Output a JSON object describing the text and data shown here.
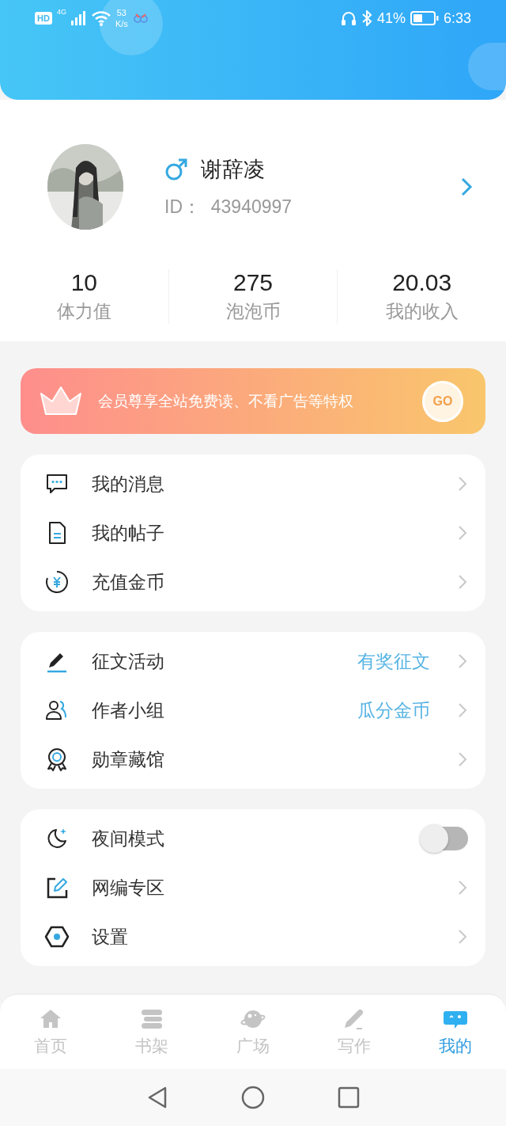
{
  "status_bar": {
    "hd": "HD",
    "network": "4G",
    "speed_value": "53",
    "speed_unit": "K/s",
    "battery": "41%",
    "time": "6:33"
  },
  "profile": {
    "name": "谢辞凌",
    "id": "ID：  43940997"
  },
  "stats": [
    {
      "value": "10",
      "label": "体力值"
    },
    {
      "value": "275",
      "label": "泡泡币"
    },
    {
      "value": "20.03",
      "label": "我的收入"
    }
  ],
  "banner": {
    "text": "会员尊享全站免费读、不看广告等特权",
    "button": "GO"
  },
  "menu_groups": [
    {
      "items": [
        {
          "kind": "link",
          "label": "我的消息"
        },
        {
          "kind": "link",
          "label": "我的帖子"
        },
        {
          "kind": "link",
          "label": "充值金币"
        }
      ]
    },
    {
      "items": [
        {
          "kind": "link",
          "label": "征文活动",
          "note": "有奖征文"
        },
        {
          "kind": "link",
          "label": "作者小组",
          "note": "瓜分金币"
        },
        {
          "kind": "link",
          "label": "勋章藏馆"
        }
      ]
    },
    {
      "items": [
        {
          "kind": "toggle",
          "label": "夜间模式",
          "on": false
        },
        {
          "kind": "link",
          "label": "网编专区"
        },
        {
          "kind": "link",
          "label": "设置"
        }
      ]
    }
  ],
  "tab_bar": [
    {
      "label": "首页",
      "selected": false
    },
    {
      "label": "书架",
      "selected": false
    },
    {
      "label": "广场",
      "selected": false
    },
    {
      "label": "写作",
      "selected": false
    },
    {
      "label": "我的",
      "selected": true
    }
  ]
}
